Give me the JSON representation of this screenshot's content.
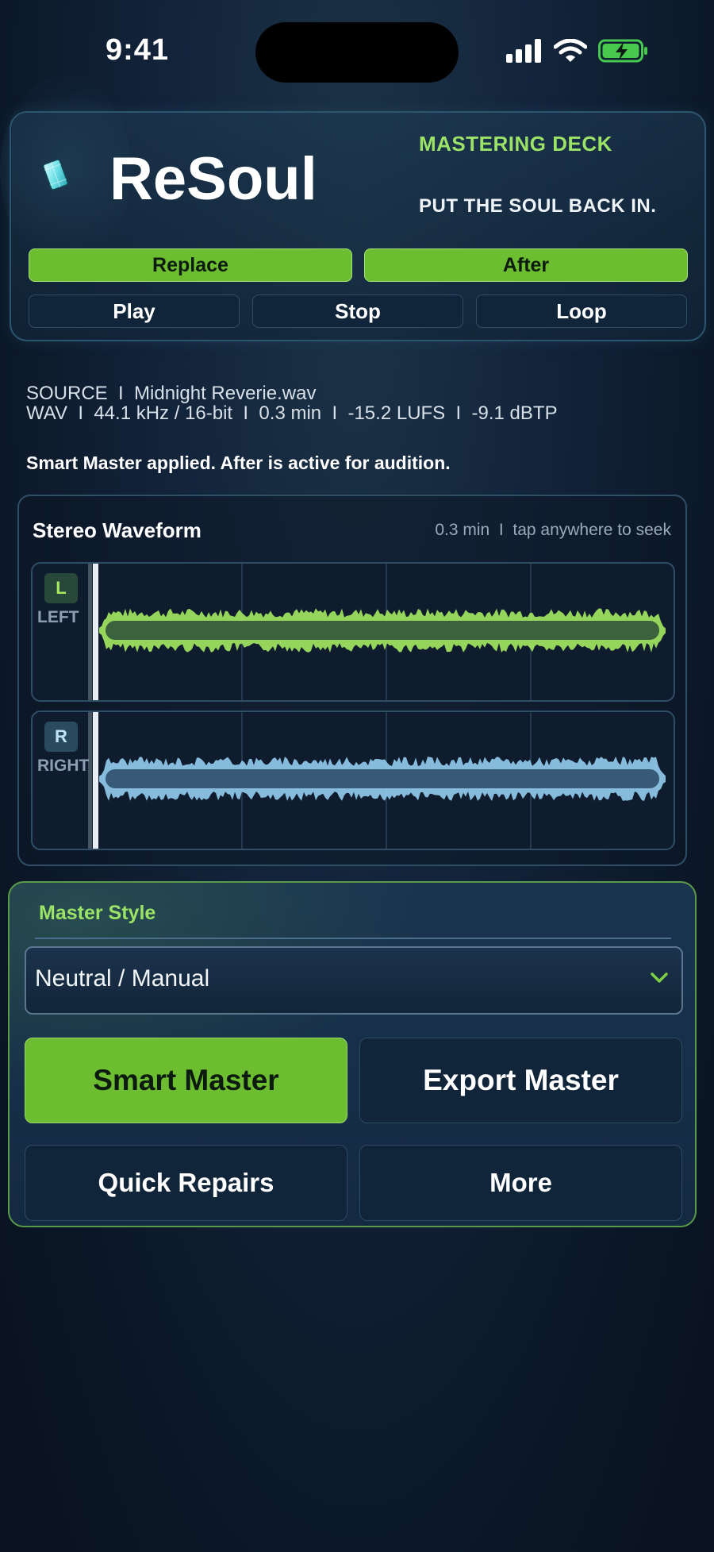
{
  "status": {
    "time": "9:41"
  },
  "header": {
    "app_title": "ReSoul",
    "deck_label": "MASTERING DECK",
    "tagline": "PUT THE SOUL BACK IN.",
    "replace_label": "Replace",
    "after_label": "After",
    "play_label": "Play",
    "stop_label": "Stop",
    "loop_label": "Loop"
  },
  "source": {
    "line1": "SOURCE  I  Midnight Reverie.wav",
    "line2": "WAV  I  44.1 kHz / 16-bit  I  0.3 min  I  -15.2 LUFS  I  -9.1 dBTP"
  },
  "notice": "Smart Master applied. After is active for audition.",
  "waveform": {
    "title": "Stereo Waveform",
    "meta": "0.3 min  I  tap anywhere to seek",
    "left": {
      "badge": "L",
      "label": "LEFT",
      "color": "#a5ea62"
    },
    "right": {
      "badge": "R",
      "label": "RIGHT",
      "color": "#93cdf0"
    }
  },
  "master_style": {
    "label": "Master Style",
    "selected": "Neutral / Manual",
    "smart_master_label": "Smart Master",
    "export_label": "Export Master",
    "quick_repairs_label": "Quick Repairs",
    "more_label": "More"
  },
  "colors": {
    "accent": "#6cbd30",
    "accent_text": "#9be267",
    "panel": "#11253a"
  }
}
